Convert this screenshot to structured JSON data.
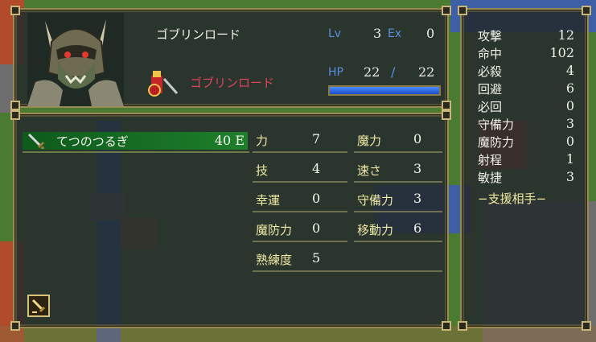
{
  "unit": {
    "name": "ゴブリンロード",
    "class": "ゴブリンロード",
    "level_label": "Lv",
    "level": "3",
    "exp_label": "Ex",
    "exp": "0",
    "hp_label": "HP",
    "hp_current": "22",
    "hp_separator": "/",
    "hp_max": "22",
    "hp_fraction": 1.0
  },
  "weapon": {
    "name": "てつのつるぎ",
    "uses": "40 E",
    "icon": "sword-icon"
  },
  "stats": [
    {
      "label": "力",
      "value": "7"
    },
    {
      "label": "魔力",
      "value": "0"
    },
    {
      "label": "技",
      "value": "4"
    },
    {
      "label": "速さ",
      "value": "3"
    },
    {
      "label": "幸運",
      "value": "0"
    },
    {
      "label": "守備力",
      "value": "3"
    },
    {
      "label": "魔防力",
      "value": "0"
    },
    {
      "label": "移動力",
      "value": "6"
    },
    {
      "label": "熟練度",
      "value": "5"
    }
  ],
  "substats": [
    {
      "label": "攻撃",
      "value": "12"
    },
    {
      "label": "命中",
      "value": "102"
    },
    {
      "label": "必殺",
      "value": "4"
    },
    {
      "label": "回避",
      "value": "6"
    },
    {
      "label": "必回",
      "value": "0"
    },
    {
      "label": "守備力",
      "value": "3"
    },
    {
      "label": "魔防力",
      "value": "0"
    },
    {
      "label": "射程",
      "value": "1"
    },
    {
      "label": "敏捷",
      "value": "3"
    }
  ],
  "support_label": "−支援相手−",
  "colors": {
    "class_name": "#e2425a",
    "blue_label": "#5b8fe0",
    "stat_label": "#f1e9a4",
    "weapon_highlight": "#1e7f2b",
    "hp_bar": "#2f6ee8",
    "panel_border": "#9a8a55"
  }
}
